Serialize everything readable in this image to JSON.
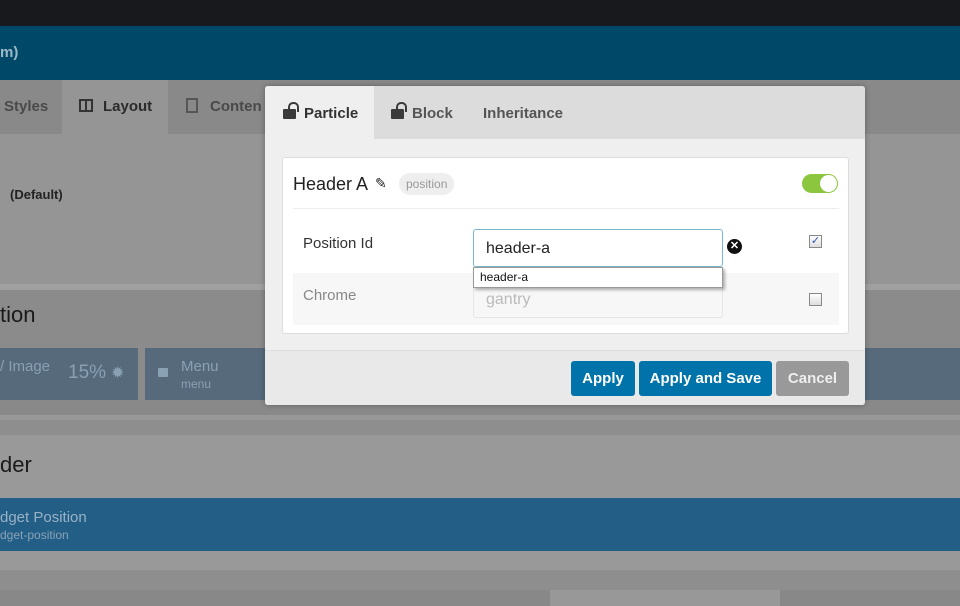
{
  "header": {
    "title_fragment": "m)"
  },
  "bg_tabs": [
    {
      "label": "Styles",
      "icon": "styles-icon"
    },
    {
      "label": "Layout",
      "icon": "layout-columns-icon"
    },
    {
      "label": "Conten",
      "icon": "document-icon"
    }
  ],
  "outline": {
    "label": "(Default)"
  },
  "sections": [
    {
      "title": "tion"
    },
    {
      "title": "der"
    }
  ],
  "blocks": [
    {
      "title": "/ Image",
      "size": "15%"
    },
    {
      "title": "Menu",
      "subtitle": "menu"
    }
  ],
  "widget": {
    "title": "dget Position",
    "subtitle": "dget-position"
  },
  "modal": {
    "tabs": [
      {
        "label": "Particle",
        "active": true
      },
      {
        "label": "Block"
      },
      {
        "label": "Inheritance"
      }
    ],
    "title": "Header A",
    "badge": "position",
    "enabled": true,
    "fields": [
      {
        "label": "Position Id",
        "value": "header-a",
        "suggestion": "header-a",
        "override": true
      },
      {
        "label": "Chrome",
        "placeholder": "gantry",
        "override": false
      }
    ],
    "buttons": {
      "apply": "Apply",
      "apply_save": "Apply and Save",
      "cancel": "Cancel"
    }
  },
  "colors": {
    "primary": "#0073aa",
    "cancel": "#999999",
    "toggle_on": "#8cc63f"
  }
}
